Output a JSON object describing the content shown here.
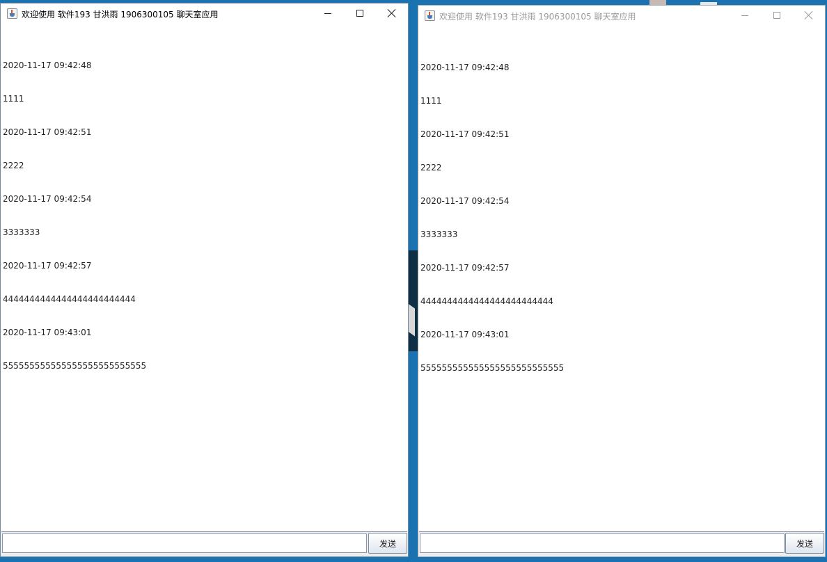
{
  "windows": [
    {
      "title": "欢迎使用 软件193 甘洪雨 1906300105 聊天室应用",
      "state": "active",
      "messages": [
        "2020-11-17 09:42:48",
        "1111",
        "2020-11-17 09:42:51",
        "2222",
        "2020-11-17 09:42:54",
        "3333333",
        "2020-11-17 09:42:57",
        "4444444444444444444444444",
        "2020-11-17 09:43:01",
        "555555555555555555555555555"
      ],
      "input_value": "",
      "send_label": "发送"
    },
    {
      "title": "欢迎使用 软件193 甘洪雨 1906300105 聊天室应用",
      "state": "inactive",
      "messages": [
        "2020-11-17 09:42:48",
        "1111",
        "2020-11-17 09:42:51",
        "2222",
        "2020-11-17 09:42:54",
        "3333333",
        "2020-11-17 09:42:57",
        "4444444444444444444444444",
        "2020-11-17 09:43:01",
        "555555555555555555555555555"
      ],
      "input_value": "",
      "send_label": "发送"
    }
  ],
  "icons": {
    "app": "java-app-icon",
    "minimize": "minimize-icon",
    "maximize": "maximize-icon",
    "close": "close-icon"
  },
  "colors": {
    "desktop": "#1a72b0",
    "window_border_active": "#6f8aa0",
    "inactive_title_text": "#9a9a9a"
  }
}
